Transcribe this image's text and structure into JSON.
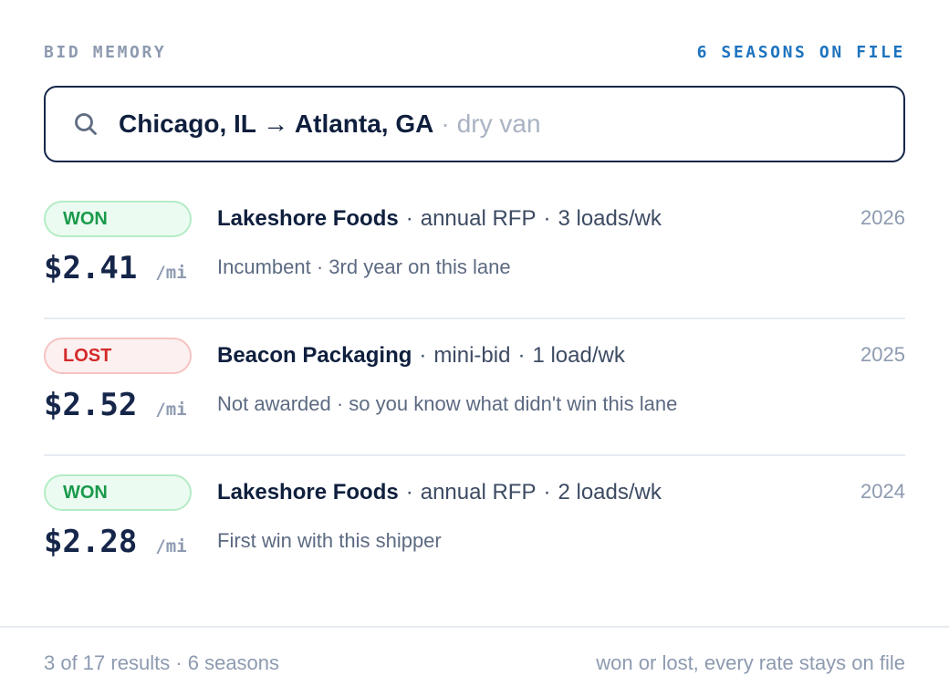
{
  "header": {
    "kicker": "BID MEMORY",
    "count": "6 SEASONS ON FILE"
  },
  "search": {
    "icon": "search-icon",
    "query": "Chicago, IL → Atlanta, GA",
    "separator": "·",
    "mode": "dry van"
  },
  "results": [
    {
      "status": "WON",
      "rate": "$2.41",
      "unit": "/mi",
      "shipper": "Lakeshore Foods",
      "bid_type": "annual RFP",
      "volume": "3 loads/wk",
      "year": "2026",
      "note": "Incumbent · 3rd year on this lane"
    },
    {
      "status": "LOST",
      "rate": "$2.52",
      "unit": "/mi",
      "shipper": "Beacon Packaging",
      "bid_type": "mini-bid",
      "volume": "1 load/wk",
      "year": "2025",
      "note": "Not awarded · so you know what didn't win this lane"
    },
    {
      "status": "WON",
      "rate": "$2.28",
      "unit": "/mi",
      "shipper": "Lakeshore Foods",
      "bid_type": "annual RFP",
      "volume": "2 loads/wk",
      "year": "2024",
      "note": "First win with this shipper"
    }
  ],
  "separator": "·",
  "footer": {
    "summary": "3 of 17 results · 6 seasons",
    "tagline": "won or lost, every rate stays on file"
  },
  "colors": {
    "won": "#1a9a4b",
    "lost": "#d42a2a",
    "accent": "#1e73be",
    "ink": "#16264a"
  }
}
